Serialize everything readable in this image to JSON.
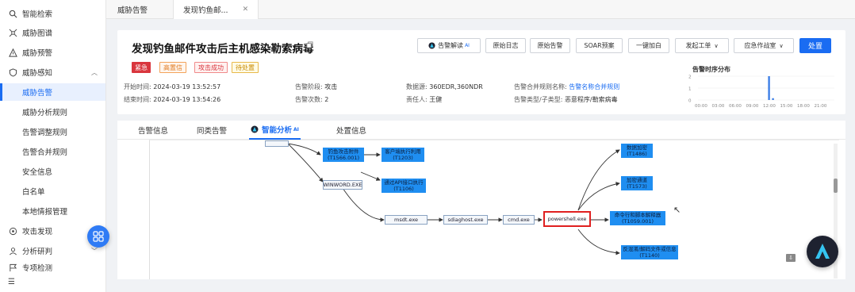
{
  "sidebar": {
    "items": [
      {
        "label": "智能检索",
        "icon": "search-icon"
      },
      {
        "label": "威胁图谱",
        "icon": "graph-icon"
      },
      {
        "label": "威胁预警",
        "icon": "warning-icon"
      },
      {
        "label": "威胁感知",
        "icon": "shield-icon"
      }
    ],
    "sub_items": [
      "威胁告警",
      "威胁分析规则",
      "告警调整规则",
      "告警合并规则",
      "安全信息",
      "白名单",
      "本地情报管理"
    ],
    "items_bottom": [
      {
        "label": "攻击发现",
        "icon": "target-icon"
      },
      {
        "label": "分析研判",
        "icon": "user-icon"
      },
      {
        "label": "专项检测",
        "icon": "flag-icon"
      }
    ]
  },
  "tabs": [
    {
      "label": "威胁告警"
    },
    {
      "label": "发现钓鱼邮..."
    }
  ],
  "header": {
    "title": "发现钓鱼邮件攻击后主机感染勒索病毒",
    "tags": [
      "紧急",
      "高置信",
      "攻击成功",
      "待处置"
    ],
    "fields": {
      "start_label": "开始时间:",
      "start_value": "2024-03-19 13:52:57",
      "end_label": "结束时间:",
      "end_value": "2024-03-19 13:54:26",
      "stage_label": "告警阶段:",
      "stage_value": "攻击",
      "count_label": "告警次数:",
      "count_value": "2",
      "source_label": "数据源:",
      "source_value": "360EDR,360NDR",
      "owner_label": "责任人:",
      "owner_value": "王健",
      "rule_label": "告警合并规则名称:",
      "rule_value": "告警名称合并规则",
      "type_label": "告警类型/子类型:",
      "type_value": "恶意程序/勒索病毒"
    },
    "buttons": {
      "interpret": "告警解读",
      "interpret_badge": "AI",
      "raw_log": "原始日志",
      "raw_alert": "原始告警",
      "soar": "SOAR预案",
      "watch": "一键加白",
      "ticket": "发起工单",
      "emergency": "应急作战室",
      "handle": "处置"
    },
    "distribution_title": "告警时序分布",
    "distribution": {
      "y_ticks": [
        "2",
        "1",
        "0"
      ],
      "x_ticks": [
        "00:00",
        "03:00",
        "06:00",
        "09:00",
        "12:00",
        "15:00",
        "18:00",
        "21:00"
      ],
      "bars": [
        {
          "hour": 12.5,
          "value": 2
        },
        {
          "hour": 13.2,
          "value": 0.15
        }
      ]
    }
  },
  "panel_tabs": [
    "告警信息",
    "同类告警",
    "智能分析",
    "处置信息"
  ],
  "panel_tab_badge": "AI",
  "graph": {
    "nodes": {
      "top_stub": "",
      "phish": [
        "钓鱼攻击附件",
        "(T1566.001)"
      ],
      "client_exec": [
        "客户端执行利用",
        "(T1203)"
      ],
      "winword": "WINWORD.EXE",
      "api_exec": [
        "通过API接口执行",
        "(T1106)"
      ],
      "msdt": "msdt.exe",
      "sdiag": "sdiaghost.exe",
      "cmd": "cmd.exe",
      "powershell": "powershell.exe",
      "data_encrypt": [
        "数据加密",
        "(T1486)"
      ],
      "encrypt_channel": [
        "加密通道",
        "(T1573)"
      ],
      "cmd_interp": [
        "命令行和脚本解释器",
        "(T1059.001)"
      ],
      "deobf": [
        "反混淆/解码文件或信息",
        "(T1140)"
      ]
    }
  },
  "colors": {
    "accent": "#1a6cf2",
    "node_blue": "#1f8ef1",
    "urgent": "#d9363e",
    "highlight": "#e02020"
  }
}
